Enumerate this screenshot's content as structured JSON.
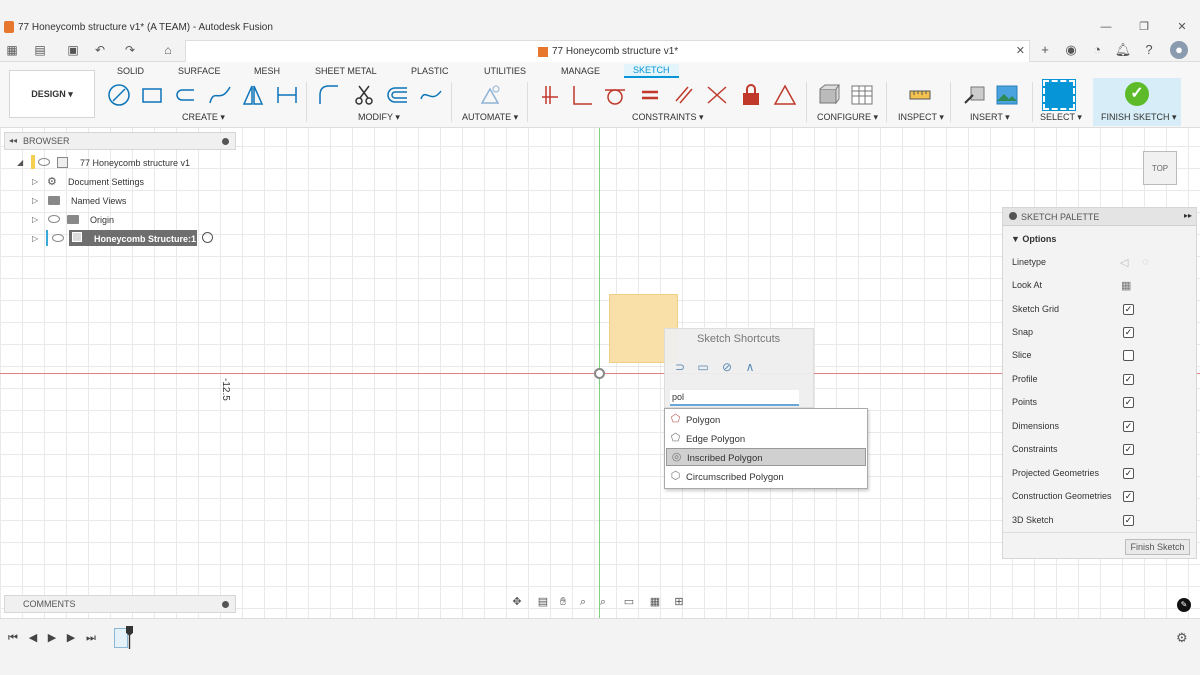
{
  "window": {
    "title": "77 Honeycomb structure v1* (A TEAM) - Autodesk Fusion",
    "controls": [
      "—",
      "❐",
      "✕"
    ]
  },
  "tabbar": {
    "doc_title": "77 Honeycomb structure v1*",
    "close": "✕",
    "add": "+"
  },
  "ribbon": {
    "workspace": "DESIGN ▾",
    "tabs": [
      "SOLID",
      "SURFACE",
      "MESH",
      "SHEET METAL",
      "PLASTIC",
      "UTILITIES",
      "MANAGE",
      "SKETCH"
    ],
    "active_tab": "SKETCH",
    "groups": {
      "create": "CREATE ▾",
      "modify": "MODIFY ▾",
      "automate": "AUTOMATE ▾",
      "constraints": "CONSTRAINTS ▾",
      "configure": "CONFIGURE ▾",
      "inspect": "INSPECT ▾",
      "insert": "INSERT ▾",
      "select": "SELECT ▾",
      "finish": "FINISH SKETCH ▾"
    },
    "accent": "#0696d7"
  },
  "browser": {
    "title": "BROWSER",
    "items": [
      {
        "label": "77 Honeycomb structure v1"
      },
      {
        "label": "Document Settings"
      },
      {
        "label": "Named Views"
      },
      {
        "label": "Origin"
      },
      {
        "label": "Honeycomb Structure:1"
      }
    ]
  },
  "comments": {
    "title": "COMMENTS"
  },
  "canvas": {
    "dimension_label": "-12.5",
    "viewcube_label": "TOP"
  },
  "shortcuts": {
    "title": "Sketch Shortcuts",
    "search_value": "pol",
    "results": [
      {
        "label": "Polygon",
        "icon": "pentagon-icon"
      },
      {
        "label": "Edge Polygon",
        "icon": "edge-polygon-icon"
      },
      {
        "label": "Inscribed Polygon",
        "icon": "inscribed-polygon-icon",
        "highlighted": true
      },
      {
        "label": "Circumscribed Polygon",
        "icon": "circumscribed-polygon-icon"
      }
    ]
  },
  "palette": {
    "title": "SKETCH PALETTE",
    "section": "Options",
    "rows": [
      {
        "label": "Linetype",
        "checked": null
      },
      {
        "label": "Look At",
        "checked": null
      },
      {
        "label": "Sketch Grid",
        "checked": true
      },
      {
        "label": "Snap",
        "checked": true
      },
      {
        "label": "Slice",
        "checked": false
      },
      {
        "label": "Profile",
        "checked": true
      },
      {
        "label": "Points",
        "checked": true
      },
      {
        "label": "Dimensions",
        "checked": true
      },
      {
        "label": "Constraints",
        "checked": true
      },
      {
        "label": "Projected Geometries",
        "checked": true
      },
      {
        "label": "Construction Geometries",
        "checked": true
      },
      {
        "label": "3D Sketch",
        "checked": true
      }
    ],
    "finish_button": "Finish Sketch"
  }
}
